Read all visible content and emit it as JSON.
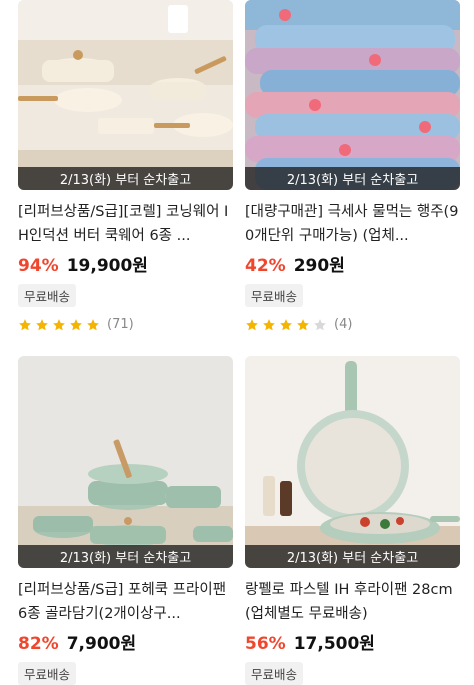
{
  "products": [
    {
      "shipping_label": "2/13(화) 부터 순차출고",
      "title": "[리퍼브상품/S급][코렐] 코닝웨어 IH인덕션 버터 쿡웨어 6종 ...",
      "discount": "94%",
      "price": "19,900원",
      "badge": "무료배송",
      "rating": 5,
      "review_count": "(71)",
      "image": "cream-cookware-set-photo"
    },
    {
      "shipping_label": "2/13(화) 부터 순차출고",
      "title": "[대량구매관] 극세사 물먹는 행주(90개단위 구매가능) (업체...",
      "discount": "42%",
      "price": "290원",
      "badge": "무료배송",
      "rating": 4,
      "review_count": "(4)",
      "image": "stacked-dish-towels-photo"
    },
    {
      "shipping_label": "2/13(화) 부터 순차출고",
      "title": "[리퍼브상품/S급] 포헤쿡 프라이팬 6종 골라담기(2개이상구...",
      "discount": "82%",
      "price": "7,900원",
      "badge": "무료배송",
      "image": "mint-cookware-set-photo"
    },
    {
      "shipping_label": "2/13(화) 부터 순차출고",
      "title": "랑펠로 파스텔 IH 후라이팬 28cm (업체별도 무료배송)",
      "discount": "56%",
      "price": "17,500원",
      "badge": "무료배송",
      "image": "pastel-frying-pan-photo"
    }
  ],
  "colors": {
    "discount": "#f0462d",
    "star": "#f5b400",
    "star_empty": "#d8d8d8"
  }
}
